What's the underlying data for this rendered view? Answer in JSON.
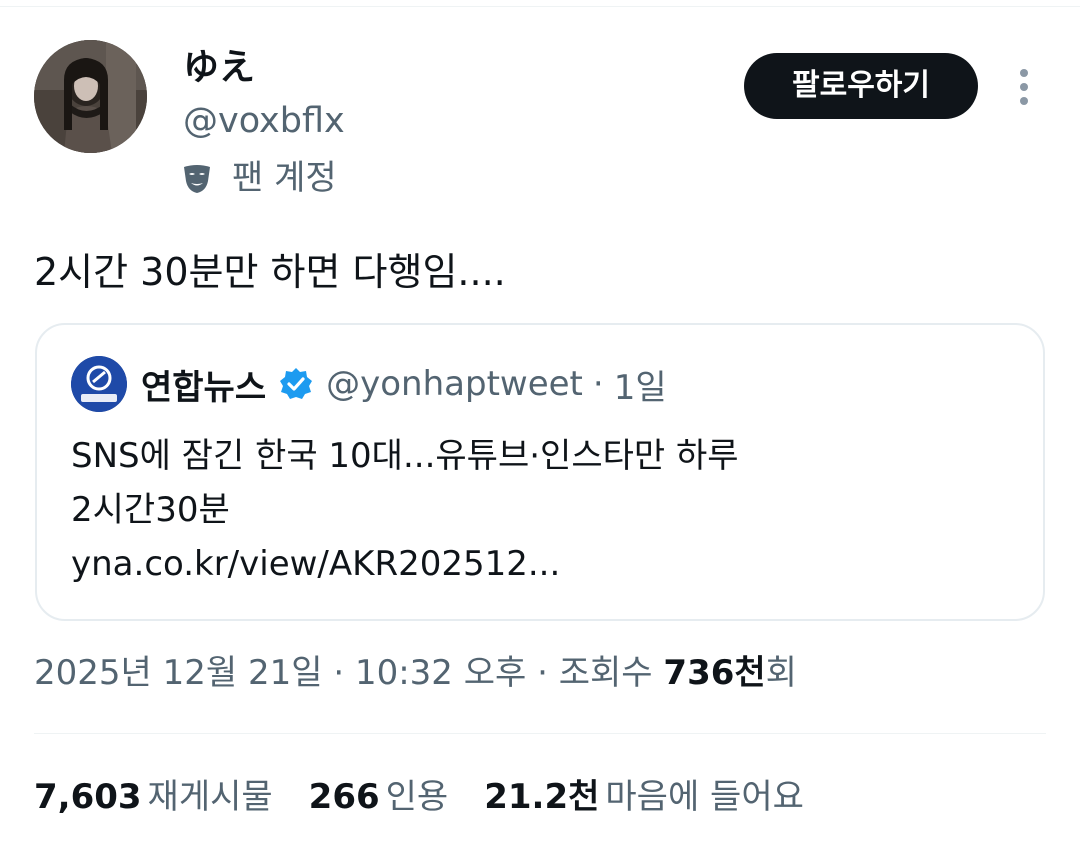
{
  "author": {
    "display_name": "ゆえ",
    "handle": "@voxbflx",
    "badge_label": "팬 계정",
    "badge_icon": "mask-icon"
  },
  "follow_button": {
    "label": "팔로우하기"
  },
  "tweet": {
    "text": "2시간 30분만 하면 다행임...."
  },
  "quote": {
    "author_name": "연합뉴스",
    "verified_icon": "verified-badge-icon",
    "handle": "@yonhaptweet",
    "separator": "·",
    "time": "1일",
    "avatar_label": "연합뉴스",
    "lines": [
      "SNS에 잠긴 한국 10대...유튜브·인스타만 하루",
      "2시간30분",
      "yna.co.kr/view/AKR202512..."
    ]
  },
  "meta": {
    "date": "2025년 12월 21일",
    "sep1": "·",
    "time": "10:32 오후",
    "sep2": "·",
    "views_label": "조회수",
    "views_count": "736천",
    "views_suffix": "회"
  },
  "stats": {
    "reposts_count": "7,603",
    "reposts_label": "재게시물",
    "quotes_count": "266",
    "quotes_label": "인용",
    "likes_count": "21.2천",
    "likes_label": "마음에 들어요"
  },
  "colors": {
    "text_primary": "#0f1419",
    "text_secondary": "#536471",
    "follow_bg": "#0f1419",
    "verified_blue": "#1d9bf0",
    "border": "#e6ecf0"
  }
}
